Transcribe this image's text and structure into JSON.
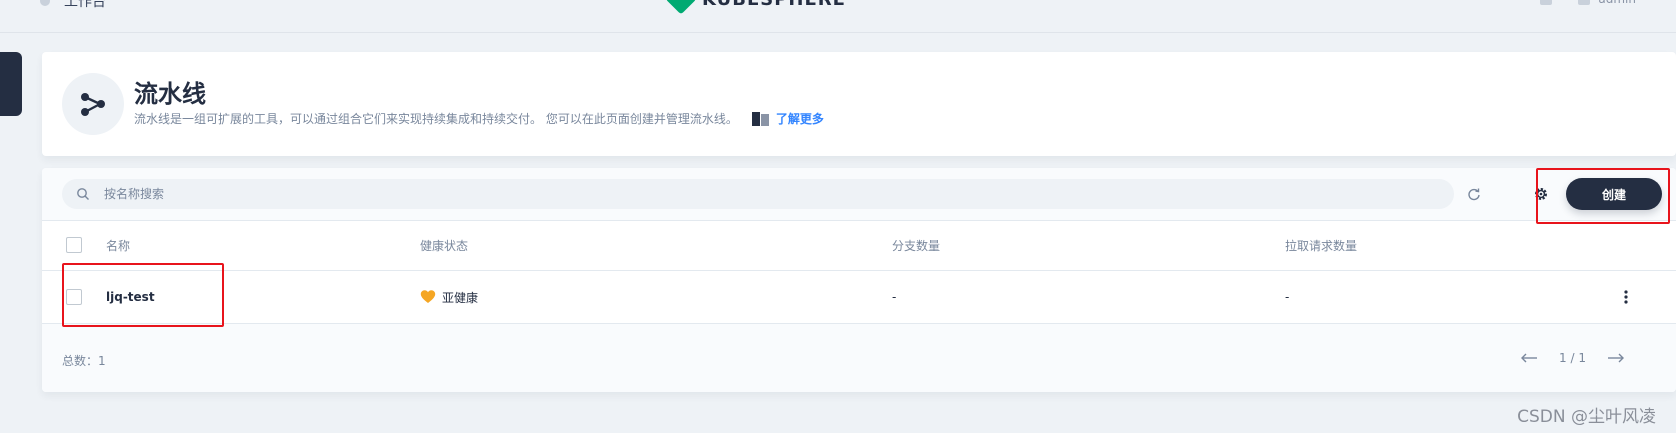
{
  "topbar": {
    "nav_label": "工作台",
    "logo_text": "KUBESPHERE",
    "user": "admin"
  },
  "header": {
    "title": "流水线",
    "description": "流水线是一组可扩展的工具，可以通过组合它们来实现持续集成和持续交付。 您可以在此页面创建并管理流水线。",
    "learn_more": "了解更多"
  },
  "toolbar": {
    "search_placeholder": "按名称搜索",
    "refresh_icon": "refresh-icon",
    "settings_icon": "gear-icon",
    "create_label": "创建"
  },
  "table": {
    "columns": [
      "名称",
      "健康状态",
      "分支数量",
      "拉取请求数量"
    ],
    "rows": [
      {
        "name": "ljq-test",
        "health": "亚健康",
        "health_icon": "heart-icon",
        "branches": "-",
        "pull_requests": "-"
      }
    ]
  },
  "footer": {
    "total": "总数：1",
    "page": "1 / 1"
  },
  "watermark": "CSDN @尘叶风凌",
  "colors": {
    "accent": "#242e42",
    "link": "#3385ff",
    "highlight": "#e8141c",
    "health_warning": "#f5a623"
  }
}
